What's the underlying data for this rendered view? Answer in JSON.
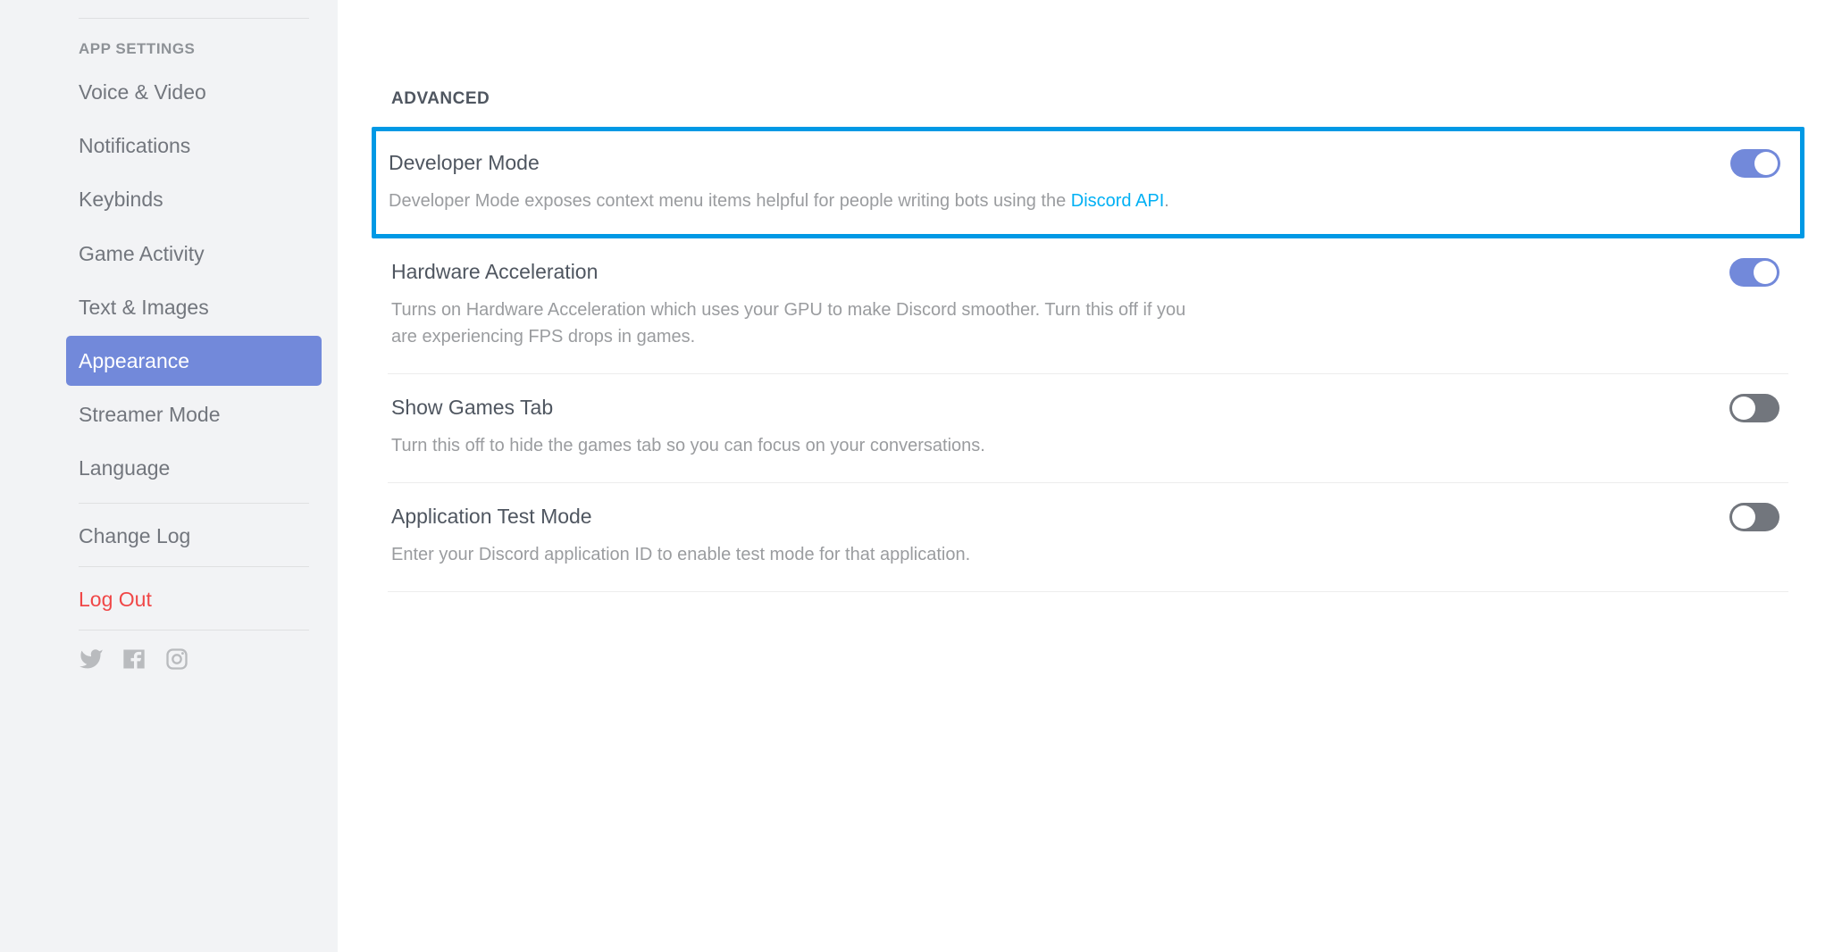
{
  "sidebar": {
    "sectionLabel": "APP SETTINGS",
    "items": [
      {
        "label": "Voice & Video",
        "active": false
      },
      {
        "label": "Notifications",
        "active": false
      },
      {
        "label": "Keybinds",
        "active": false
      },
      {
        "label": "Game Activity",
        "active": false
      },
      {
        "label": "Text & Images",
        "active": false
      },
      {
        "label": "Appearance",
        "active": true
      },
      {
        "label": "Streamer Mode",
        "active": false
      },
      {
        "label": "Language",
        "active": false
      }
    ],
    "changeLog": "Change Log",
    "logout": "Log Out"
  },
  "main": {
    "sectionHeader": "ADVANCED",
    "settings": [
      {
        "title": "Developer Mode",
        "desc_prefix": "Developer Mode exposes context menu items helpful for people writing bots using the ",
        "desc_link": "Discord API",
        "desc_suffix": ".",
        "toggle": true,
        "highlighted": true
      },
      {
        "title": "Hardware Acceleration",
        "desc": "Turns on Hardware Acceleration which uses your GPU to make Discord smoother. Turn this off if you are experiencing FPS drops in games.",
        "toggle": true
      },
      {
        "title": "Show Games Tab",
        "desc": "Turn this off to hide the games tab so you can focus on your conversations.",
        "toggle": false
      },
      {
        "title": "Application Test Mode",
        "desc": "Enter your Discord application ID to enable test mode for that application.",
        "toggle": false
      }
    ]
  },
  "colors": {
    "accent": "#7289da",
    "highlight": "#0099e5",
    "link": "#00b0f4",
    "danger": "#f04747"
  }
}
